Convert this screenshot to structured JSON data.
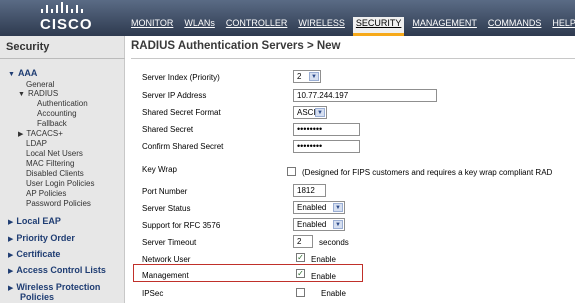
{
  "brand": {
    "logo_text": "CISCO"
  },
  "menu": [
    {
      "label": "MONITOR",
      "active": false
    },
    {
      "label": "WLANs",
      "active": false
    },
    {
      "label": "CONTROLLER",
      "active": false
    },
    {
      "label": "WIRELESS",
      "active": false
    },
    {
      "label": "SECURITY",
      "active": true
    },
    {
      "label": "MANAGEMENT",
      "active": false
    },
    {
      "label": "COMMANDS",
      "active": false
    },
    {
      "label": "HELP",
      "active": false
    }
  ],
  "sidebar": {
    "title": "Security",
    "aaa": "AAA",
    "general": "General",
    "radius": "RADIUS",
    "authentication": "Authentication",
    "accounting": "Accounting",
    "fallback": "Fallback",
    "tacacs": "TACACS+",
    "ldap": "LDAP",
    "local_net_users": "Local Net Users",
    "mac_filtering": "MAC Filtering",
    "disabled_clients": "Disabled Clients",
    "user_login_policies": "User Login Policies",
    "ap_policies": "AP Policies",
    "password_policies": "Password Policies",
    "local_eap": "Local EAP",
    "priority_order": "Priority Order",
    "certificate": "Certificate",
    "access_control_lists": "Access Control Lists",
    "wireless_protection_1": "Wireless Protection",
    "wireless_protection_2": "Policies"
  },
  "page": {
    "title": "RADIUS Authentication Servers > New"
  },
  "form": {
    "server_index": {
      "label": "Server Index (Priority)",
      "value": "2"
    },
    "server_ip": {
      "label": "Server IP Address",
      "value": "10.77.244.197"
    },
    "secret_format": {
      "label": "Shared Secret Format",
      "value": "ASCII"
    },
    "shared_secret": {
      "label": "Shared Secret",
      "value": "••••••••"
    },
    "confirm_secret": {
      "label": "Confirm Shared Secret",
      "value": "••••••••"
    },
    "key_wrap": {
      "label": "Key Wrap",
      "note": "(Designed for FIPS customers and requires a key wrap compliant RAD",
      "checked": false
    },
    "port_number": {
      "label": "Port Number",
      "value": "1812"
    },
    "server_status": {
      "label": "Server Status",
      "value": "Enabled"
    },
    "rfc3576": {
      "label": "Support for RFC 3576",
      "value": "Enabled"
    },
    "server_timeout": {
      "label": "Server Timeout",
      "value": "2",
      "unit": "seconds"
    },
    "network_user": {
      "label": "Network User",
      "checked": true,
      "text": "Enable"
    },
    "management": {
      "label": "Management",
      "checked": true,
      "text": "Enable"
    },
    "ipsec": {
      "label": "IPSec",
      "checked": false,
      "text": "Enable"
    }
  },
  "colors": {
    "header": "#2e3a4f",
    "active_tab_underline": "#f6a91a",
    "highlight_box": "#c0302a",
    "nav_link": "#1f3d73"
  }
}
